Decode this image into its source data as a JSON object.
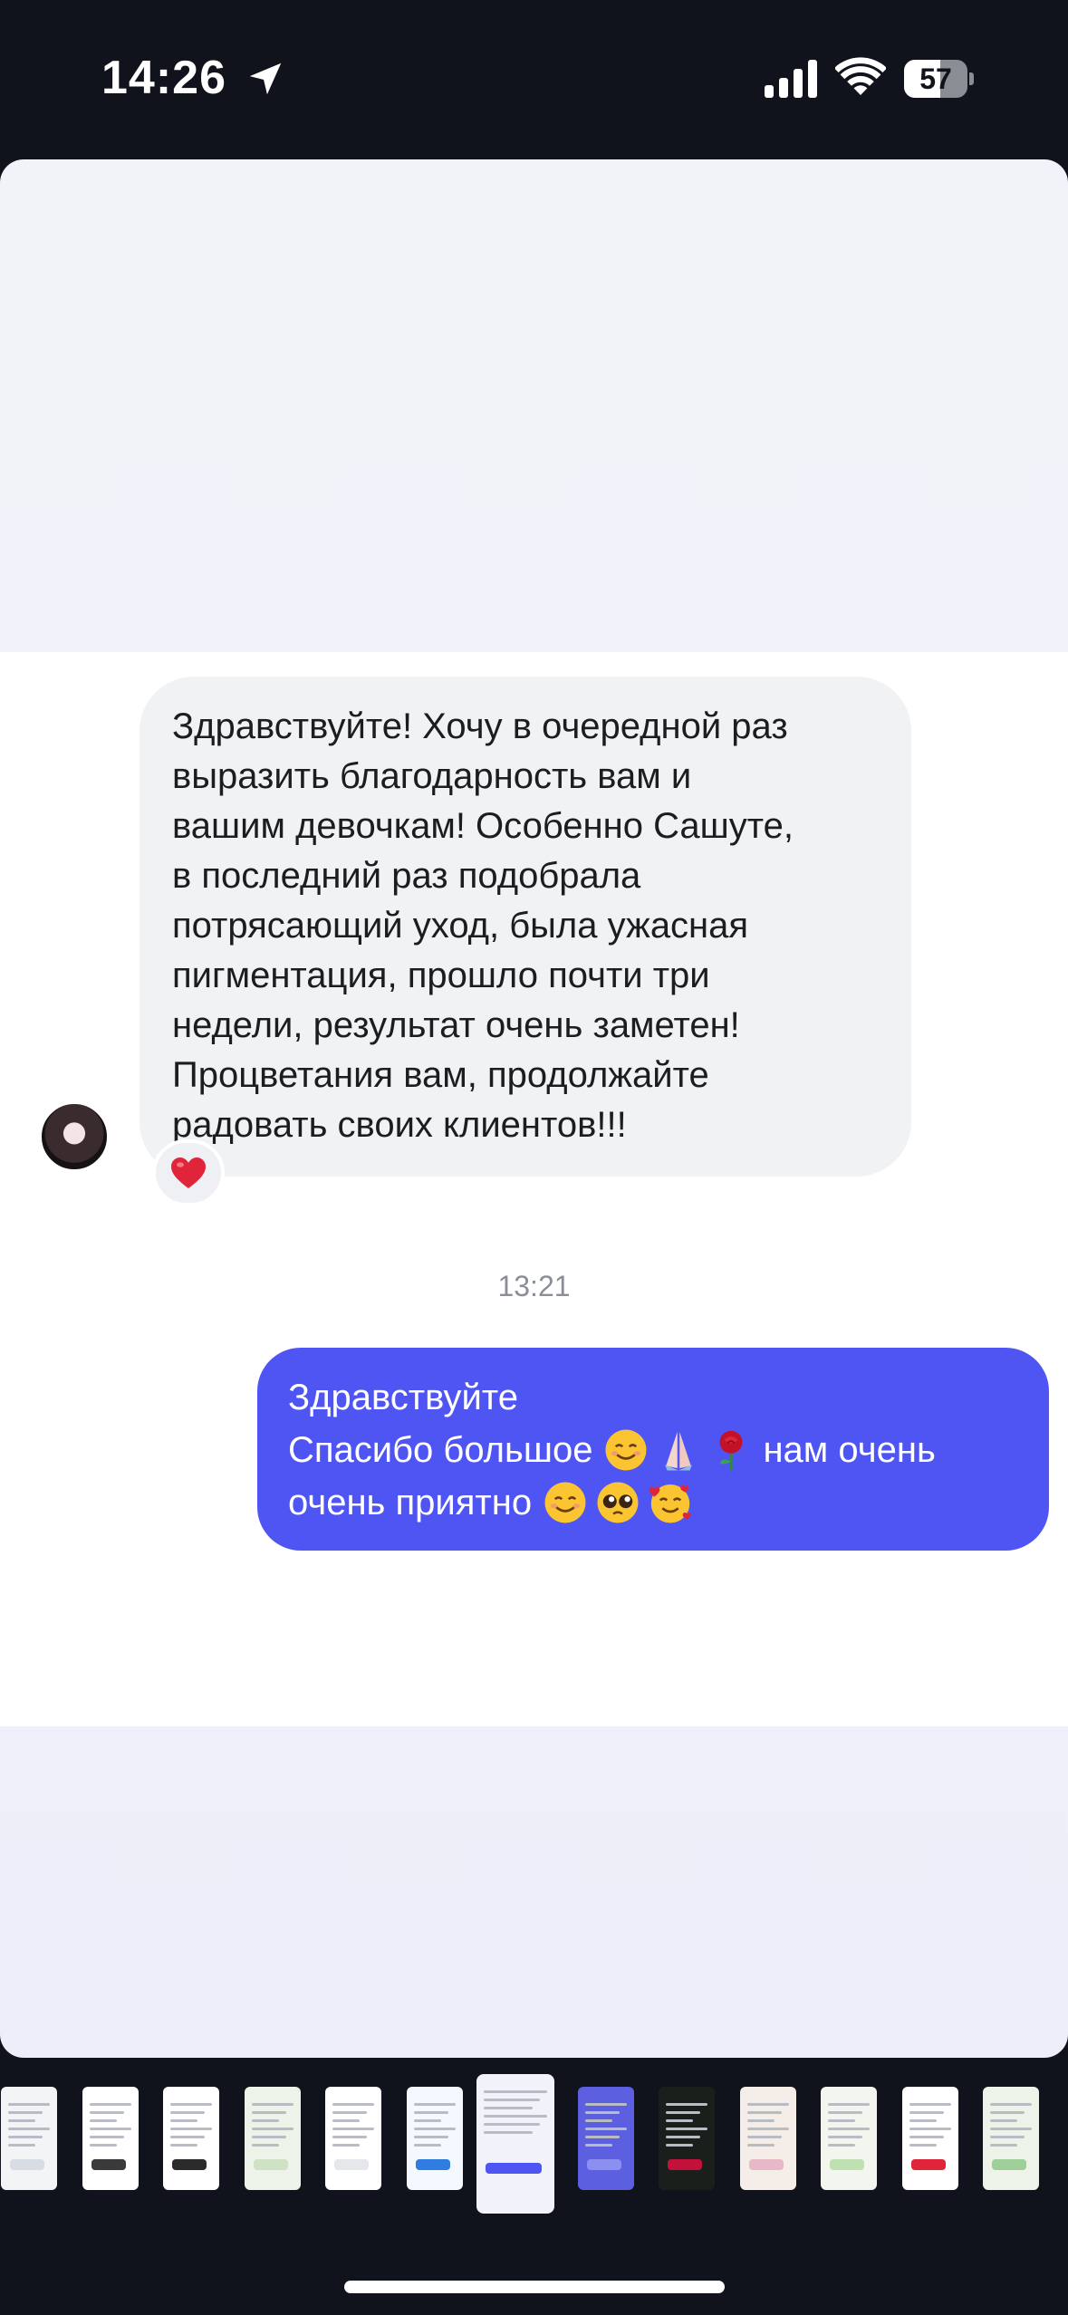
{
  "status_bar": {
    "time": "14:26",
    "battery_level": "57",
    "battery_fraction": 0.57,
    "icons": [
      "location-arrow-icon",
      "cellular-signal-icon",
      "wifi-icon",
      "battery-icon"
    ]
  },
  "conversation": {
    "incoming_message": {
      "text": "Здравствуйте! Хочу в очередной раз\nвыразить благодарность вам и\nвашим девочкам! Особенно Сашуте,\nв последний раз подобрала\nпотрясающий уход, была ужасная\nпигментация, прошло почти три\nнедели, результат очень заметен!\nПроцветания вам, продолжайте\nрадовать своих клиентов!!!",
      "reaction": "heart-emoji-icon"
    },
    "timestamp": "13:21",
    "outgoing_message": {
      "line1": "Здравствуйте",
      "line2": "Спасибо большое",
      "line2_emojis": [
        "smiling-face-icon",
        "folded-hands-icon",
        "rose-icon"
      ],
      "line2_tail": "нам очень",
      "line3": "очень приятно",
      "line3_emojis": [
        "smiling-face-icon",
        "pleading-face-icon",
        "smiling-face-with-hearts-icon"
      ]
    }
  },
  "colors": {
    "background": "#10131b",
    "outgoing_bubble": "#4f55f2",
    "incoming_bubble": "#f0f2f4",
    "reaction": "#e0243a"
  },
  "thumbnails": {
    "count": 13,
    "selected_index": 6
  }
}
